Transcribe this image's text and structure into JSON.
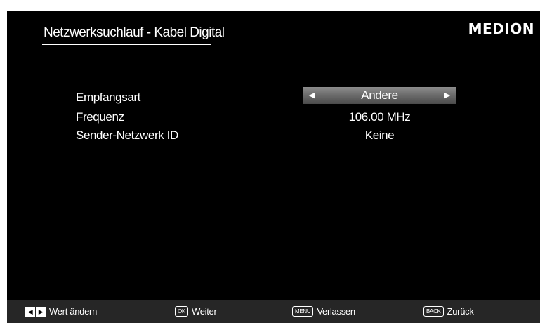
{
  "header": {
    "title": "Netzwerksuchlauf - Kabel Digital",
    "logo_text": "MEDION"
  },
  "settings": {
    "reception_type": {
      "label": "Empfangsart",
      "value": "Andere",
      "left_arrow": "◀",
      "right_arrow": "▶"
    },
    "frequency": {
      "label": "Frequenz",
      "value": "106.00 MHz"
    },
    "network_id": {
      "label": "Sender-Netzwerk ID",
      "value": "Keine"
    }
  },
  "footer": {
    "change_value": {
      "left_icon": "◀",
      "right_icon": "▶",
      "label": "Wert ändern"
    },
    "ok": {
      "key": "OK",
      "label": "Weiter"
    },
    "menu": {
      "key": "MENU",
      "label": "Verlassen"
    },
    "back": {
      "key": "BACK",
      "label": "Zurück"
    }
  },
  "colors": {
    "background": "#000000",
    "text": "#ffffff",
    "selector": "#6a6a6a",
    "footer_bar": "#262626"
  }
}
